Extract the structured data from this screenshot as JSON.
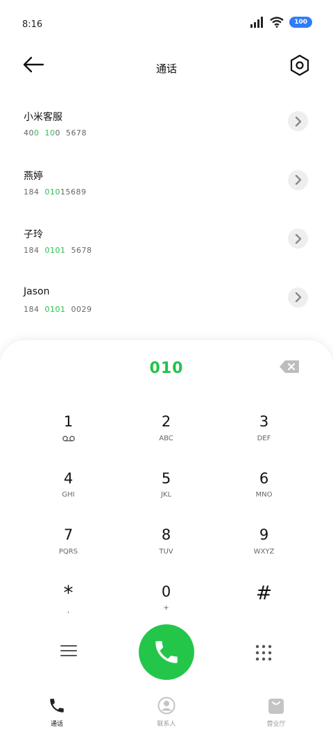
{
  "status_bar": {
    "time": "8:16",
    "battery": "100"
  },
  "header": {
    "title": "通话"
  },
  "contacts": [
    {
      "name": "小米客服",
      "number_parts": [
        {
          "text": "40",
          "hl": false
        },
        {
          "text": "0",
          "hl": true
        },
        {
          "text": "  ",
          "hl": false
        },
        {
          "text": "10",
          "hl": true
        },
        {
          "text": "0  5678",
          "hl": false
        }
      ]
    },
    {
      "name": "燕婷",
      "number_parts": [
        {
          "text": "184  ",
          "hl": false
        },
        {
          "text": "010",
          "hl": true
        },
        {
          "text": "15689",
          "hl": false
        }
      ]
    },
    {
      "name": "子玲",
      "number_parts": [
        {
          "text": "184  ",
          "hl": false
        },
        {
          "text": "0101",
          "hl": true
        },
        {
          "text": "  5678",
          "hl": false
        }
      ]
    },
    {
      "name": "Jason",
      "number_parts": [
        {
          "text": "184  ",
          "hl": false
        },
        {
          "text": "0101",
          "hl": true
        },
        {
          "text": "  0029",
          "hl": false
        }
      ]
    }
  ],
  "dialer": {
    "input": "010",
    "keys": [
      {
        "digit": "1",
        "letters": ""
      },
      {
        "digit": "2",
        "letters": "ABC"
      },
      {
        "digit": "3",
        "letters": "DEF"
      },
      {
        "digit": "4",
        "letters": "GHI"
      },
      {
        "digit": "5",
        "letters": "JKL"
      },
      {
        "digit": "6",
        "letters": "MNO"
      },
      {
        "digit": "7",
        "letters": "PQRS"
      },
      {
        "digit": "8",
        "letters": "TUV"
      },
      {
        "digit": "9",
        "letters": "WXYZ"
      },
      {
        "digit": "*",
        "letters": ","
      },
      {
        "digit": "0",
        "letters": "+"
      },
      {
        "digit": "#",
        "letters": ""
      }
    ],
    "accent_color": "#24c64a"
  },
  "bottom_nav": {
    "items": [
      {
        "label": "通话",
        "icon": "phone-icon",
        "active": true
      },
      {
        "label": "联系人",
        "icon": "contact-icon",
        "active": false
      },
      {
        "label": "营业厅",
        "icon": "store-icon",
        "active": false
      }
    ]
  }
}
